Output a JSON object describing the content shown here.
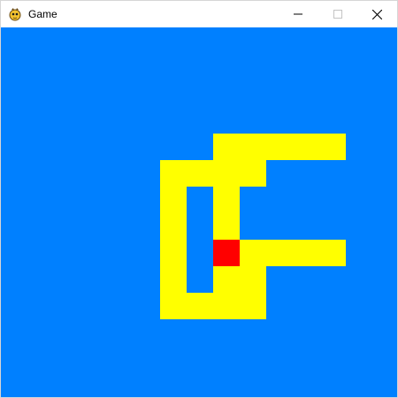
{
  "window": {
    "title": "Game",
    "icon": "pygame-snake-icon",
    "controls": {
      "minimize_icon": "minimize-icon",
      "maximize_icon": "maximize-icon",
      "close_icon": "close-icon"
    }
  },
  "game": {
    "background_color": "#0080ff",
    "snake_color": "#ffff00",
    "food_color": "#ff0000",
    "grid_columns": 15,
    "grid_rows": 14,
    "snake": [
      [
        6,
        5
      ],
      [
        7,
        5
      ],
      [
        8,
        5
      ],
      [
        8,
        4
      ],
      [
        9,
        4
      ],
      [
        10,
        4
      ],
      [
        11,
        4
      ],
      [
        12,
        4
      ],
      [
        8,
        6
      ],
      [
        8,
        7
      ],
      [
        8,
        8
      ],
      [
        8,
        9
      ],
      [
        8,
        10
      ],
      [
        7,
        10
      ],
      [
        6,
        10
      ],
      [
        6,
        9
      ],
      [
        6,
        8
      ],
      [
        6,
        7
      ],
      [
        6,
        6
      ],
      [
        6,
        5
      ],
      [
        7,
        5
      ],
      [
        8,
        5
      ],
      [
        9,
        5
      ],
      [
        9,
        8
      ],
      [
        9,
        9
      ],
      [
        10,
        8
      ],
      [
        11,
        8
      ],
      [
        12,
        8
      ],
      [
        9,
        10
      ]
    ],
    "food": [
      8,
      8
    ]
  }
}
